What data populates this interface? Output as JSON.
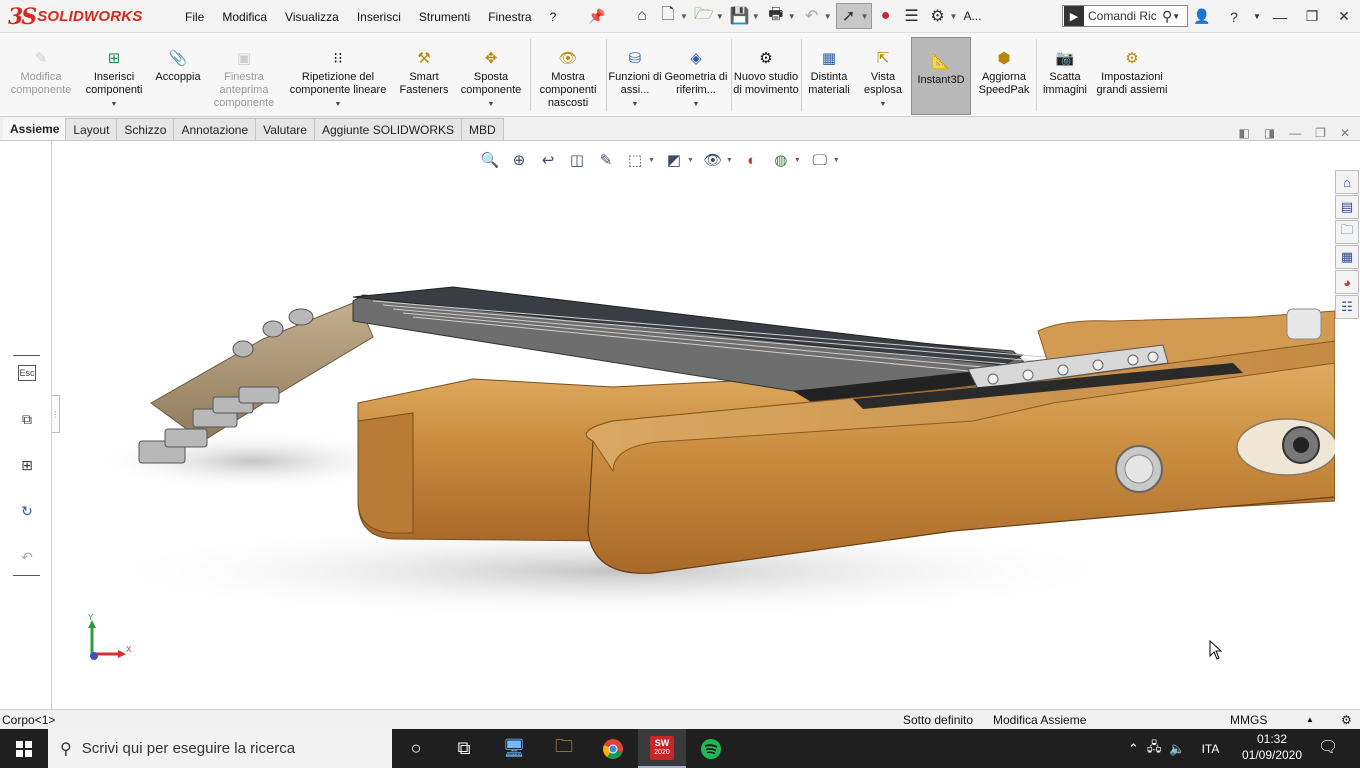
{
  "app": {
    "brand_prefix": "3S",
    "brand_name": "SOLIDWORKS"
  },
  "menu": [
    "File",
    "Modifica",
    "Visualizza",
    "Inserisci",
    "Strumenti",
    "Finestra",
    "?"
  ],
  "quick_access": {
    "label_short": "A...",
    "search_placeholder": "Comandi Ric"
  },
  "commands": [
    {
      "label": "Modifica componente",
      "disabled": true
    },
    {
      "label": "Inserisci componenti",
      "disabled": false,
      "dropdown": true
    },
    {
      "label": "Accoppia",
      "disabled": false
    },
    {
      "label": "Finestra anteprima componente",
      "disabled": true
    },
    {
      "label": "Ripetizione del componente lineare",
      "disabled": false,
      "dropdown": true
    },
    {
      "label": "Smart Fasteners",
      "disabled": false
    },
    {
      "label": "Sposta componente",
      "disabled": false,
      "dropdown": true
    },
    {
      "label": "Mostra componenti nascosti",
      "disabled": false
    },
    {
      "label": "Funzioni di assi...",
      "disabled": false,
      "dropdown": true
    },
    {
      "label": "Geometria di riferim...",
      "disabled": false,
      "dropdown": true
    },
    {
      "label": "Nuovo studio di movimento",
      "disabled": false
    },
    {
      "label": "Distinta materiali",
      "disabled": false
    },
    {
      "label": "Vista esplosa",
      "disabled": false,
      "dropdown": true
    },
    {
      "label": "Instant3D",
      "disabled": false,
      "active": true
    },
    {
      "label": "Aggiorna SpeedPak",
      "disabled": false
    },
    {
      "label": "Scatta immagini",
      "disabled": false
    },
    {
      "label": "Impostazioni grandi assiemi",
      "disabled": false
    }
  ],
  "tabs": [
    {
      "label": "Assieme",
      "active": true
    },
    {
      "label": "Layout"
    },
    {
      "label": "Schizzo"
    },
    {
      "label": "Annotazione"
    },
    {
      "label": "Valutare"
    },
    {
      "label": "Aggiunte SOLIDWORKS"
    },
    {
      "label": "MBD"
    }
  ],
  "left_panel": {
    "esc_label": "Esc"
  },
  "triad": {
    "y_label": "Y",
    "x_label": "X"
  },
  "status": {
    "selection": "Corpo<1>",
    "definition": "Sotto definito",
    "mode": "Modifica Assieme",
    "units": "MMGS"
  },
  "taskbar": {
    "search_placeholder": "Scrivi qui per eseguire la ricerca",
    "sw_badge": "2020",
    "language": "ITA",
    "time": "01:32",
    "date": "01/09/2020"
  },
  "colors": {
    "brand_red": "#d52b1e",
    "wood": "#c8893e",
    "taskbar": "#1f1f1f"
  }
}
